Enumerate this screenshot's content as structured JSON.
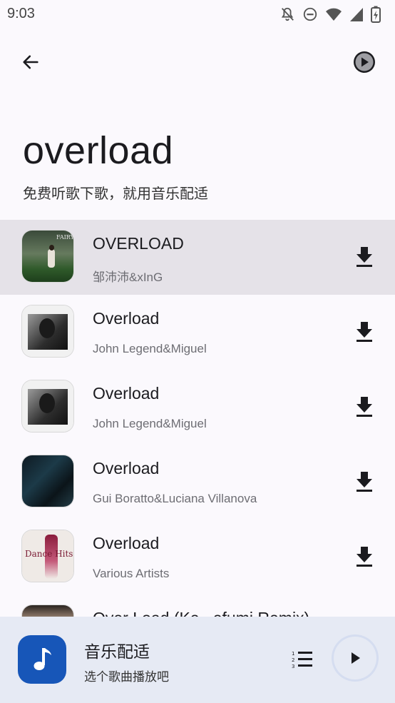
{
  "status_bar": {
    "time": "9:03",
    "icons": [
      "mute-icon",
      "dnd-icon",
      "wifi-icon",
      "signal-icon",
      "battery-icon"
    ]
  },
  "header": {
    "back_icon": "back-arrow-icon",
    "play_icon": "play-circle-icon"
  },
  "page": {
    "title": "overload",
    "subtitle": "免费听歌下歌，就用音乐配适"
  },
  "songs": [
    {
      "title": "OVERLOAD",
      "artist": "邹沛沛&xInG",
      "selected": true
    },
    {
      "title": "Overload",
      "artist": "John Legend&Miguel",
      "selected": false
    },
    {
      "title": "Overload",
      "artist": "John Legend&Miguel",
      "selected": false
    },
    {
      "title": "Overload",
      "artist": "Gui Boratto&Luciana Villanova",
      "selected": false
    },
    {
      "title": "Overload",
      "artist": "Various Artists",
      "selected": false
    },
    {
      "title": "Over Load (Ke...efumi Remix)",
      "artist": "",
      "selected": false
    }
  ],
  "player": {
    "name": "音乐配适",
    "subtitle": "选个歌曲播放吧",
    "accent": "#1756b8"
  }
}
